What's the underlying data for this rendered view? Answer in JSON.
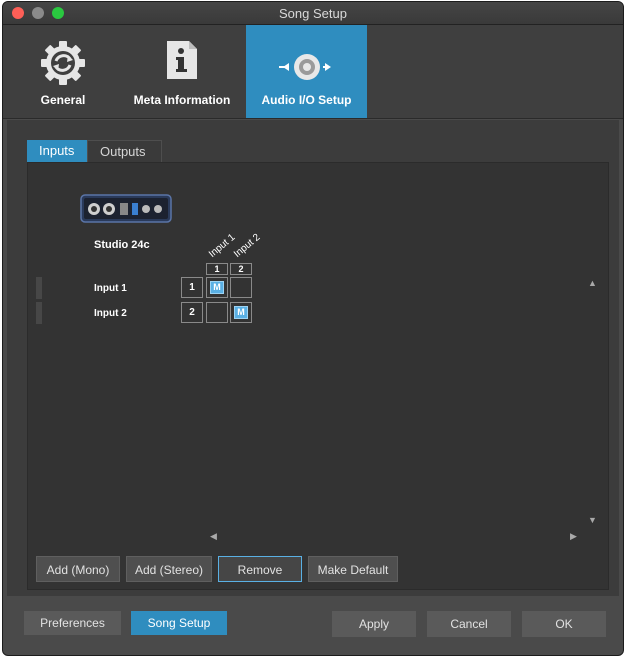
{
  "window": {
    "title": "Song Setup"
  },
  "toolbar": {
    "items": [
      {
        "label": "General",
        "icon": "gear-icon"
      },
      {
        "label": "Meta Information",
        "icon": "info-document-icon"
      },
      {
        "label": "Audio I/O Setup",
        "icon": "speaker-io-icon",
        "selected": true
      }
    ]
  },
  "tabs": [
    {
      "label": "Inputs",
      "selected": true
    },
    {
      "label": "Outputs",
      "selected": false
    }
  ],
  "matrix": {
    "device_name": "Studio 24c",
    "columns": [
      {
        "name": "Input 1",
        "number": "1"
      },
      {
        "name": "Input 2",
        "number": "2"
      }
    ],
    "rows": [
      {
        "label": "Input 1",
        "number": "1",
        "assigned": [
          "M",
          ""
        ]
      },
      {
        "label": "Input 2",
        "number": "2",
        "assigned": [
          "",
          "M"
        ]
      }
    ]
  },
  "actions": {
    "add_mono": "Add (Mono)",
    "add_stereo": "Add (Stereo)",
    "remove": "Remove",
    "make_default": "Make Default"
  },
  "footer": {
    "preferences": "Preferences",
    "song_setup": "Song Setup",
    "apply": "Apply",
    "cancel": "Cancel",
    "ok": "OK"
  },
  "colors": {
    "accent": "#2f8dbf",
    "highlight": "#5ab0e4",
    "background": "#3c3c3c"
  }
}
